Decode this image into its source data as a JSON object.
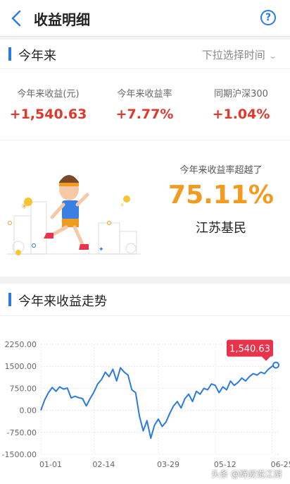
{
  "header": {
    "title": "收益明细",
    "back_icon": "chevron-left-icon",
    "help_glyph": "?"
  },
  "section1": {
    "title": "今年来",
    "dropdown_label": "下拉选择时间",
    "stats": [
      {
        "label": "今年来收益(元)",
        "value": "+1,540.63"
      },
      {
        "label": "今年来收益率",
        "value": "+7.77%"
      },
      {
        "label": "同期沪深300",
        "value": "+1.04%"
      }
    ],
    "beat": {
      "label": "今年来收益率超越了",
      "percent": "75.11%",
      "who": "江苏基民"
    }
  },
  "section2": {
    "title": "今年来收益走势",
    "watermark": "头条 @辉叔说江湖"
  },
  "colors": {
    "accent": "#2a7ae2",
    "gain": "#e0382b",
    "orange": "#f39b1e",
    "tooltip": "#e8334a"
  },
  "chart_data": {
    "type": "line",
    "series": [
      {
        "values": [
          {
            "x": "01-01",
            "y": 0
          },
          {
            "x": "01-03",
            "y": 350
          },
          {
            "x": "01-06",
            "y": 600
          },
          {
            "x": "01-09",
            "y": 780
          },
          {
            "x": "01-12",
            "y": 650
          },
          {
            "x": "01-15",
            "y": 800
          },
          {
            "x": "01-20",
            "y": 720
          },
          {
            "x": "01-25",
            "y": 760
          },
          {
            "x": "01-28",
            "y": 420
          },
          {
            "x": "02-01",
            "y": 480
          },
          {
            "x": "02-05",
            "y": 430
          },
          {
            "x": "02-08",
            "y": 400
          },
          {
            "x": "02-11",
            "y": 150
          },
          {
            "x": "02-13",
            "y": 400
          },
          {
            "x": "02-14",
            "y": 620
          },
          {
            "x": "02-17",
            "y": 900
          },
          {
            "x": "02-20",
            "y": 1050
          },
          {
            "x": "02-23",
            "y": 1300
          },
          {
            "x": "02-26",
            "y": 1150
          },
          {
            "x": "02-28",
            "y": 1400
          },
          {
            "x": "03-02",
            "y": 1000
          },
          {
            "x": "03-05",
            "y": 1450
          },
          {
            "x": "03-08",
            "y": 1300
          },
          {
            "x": "03-11",
            "y": 1200
          },
          {
            "x": "03-14",
            "y": 700
          },
          {
            "x": "03-17",
            "y": 600
          },
          {
            "x": "03-20",
            "y": -200
          },
          {
            "x": "03-22",
            "y": -700
          },
          {
            "x": "03-24",
            "y": -350
          },
          {
            "x": "03-26",
            "y": -950
          },
          {
            "x": "03-28",
            "y": -500
          },
          {
            "x": "03-29",
            "y": -300
          },
          {
            "x": "04-01",
            "y": -550
          },
          {
            "x": "04-04",
            "y": -400
          },
          {
            "x": "04-07",
            "y": -100
          },
          {
            "x": "04-10",
            "y": 150
          },
          {
            "x": "04-13",
            "y": 300
          },
          {
            "x": "04-16",
            "y": 80
          },
          {
            "x": "04-19",
            "y": 400
          },
          {
            "x": "04-22",
            "y": 550
          },
          {
            "x": "04-25",
            "y": 300
          },
          {
            "x": "04-28",
            "y": 650
          },
          {
            "x": "05-01",
            "y": 550
          },
          {
            "x": "05-04",
            "y": 750
          },
          {
            "x": "05-07",
            "y": 700
          },
          {
            "x": "05-10",
            "y": 900
          },
          {
            "x": "05-12",
            "y": 850
          },
          {
            "x": "05-15",
            "y": 600
          },
          {
            "x": "05-18",
            "y": 800
          },
          {
            "x": "05-21",
            "y": 700
          },
          {
            "x": "05-24",
            "y": 1000
          },
          {
            "x": "05-27",
            "y": 850
          },
          {
            "x": "05-30",
            "y": 950
          },
          {
            "x": "06-02",
            "y": 1100
          },
          {
            "x": "06-05",
            "y": 1000
          },
          {
            "x": "06-08",
            "y": 1150
          },
          {
            "x": "06-11",
            "y": 1250
          },
          {
            "x": "06-14",
            "y": 1200
          },
          {
            "x": "06-17",
            "y": 1300
          },
          {
            "x": "06-20",
            "y": 1250
          },
          {
            "x": "06-23",
            "y": 1400
          },
          {
            "x": "06-25",
            "y": 1500
          },
          {
            "x": "06-28",
            "y": 1540.63
          }
        ]
      }
    ],
    "y_ticks": [
      "2250.00",
      "1500.00",
      "750.00",
      "0.00",
      "-750.00",
      "-1500.00"
    ],
    "x_ticks": [
      "01-01",
      "02-14",
      "03-29",
      "05-12",
      "06-25"
    ],
    "ylim": [
      -1500,
      2250
    ],
    "last_value_label": "1,540.63",
    "grid": true
  }
}
